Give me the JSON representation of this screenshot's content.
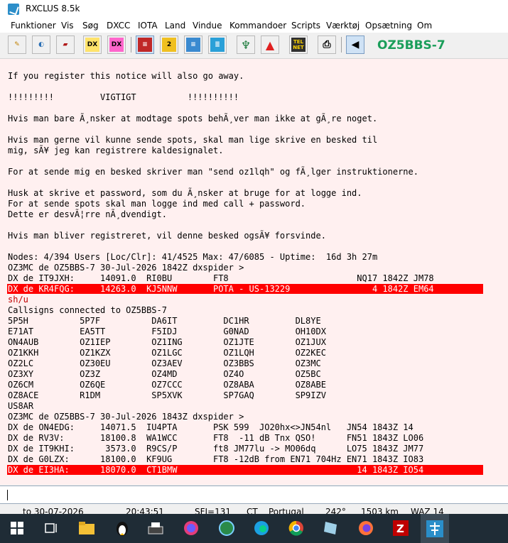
{
  "window": {
    "title": "RXCLUS 8.5k",
    "callsign": "OZ5BBS-7"
  },
  "menu": [
    "Funktioner",
    "Vis",
    "Søg",
    "DXCC",
    "IOTA",
    "Land",
    "Vindue",
    "Kommandoer",
    "Scripts",
    "Værktøj",
    "Opsætning",
    "Om"
  ],
  "toolbar": {
    "buttons": [
      {
        "name": "pin-icon",
        "label": ""
      },
      {
        "name": "radar-icon",
        "label": ""
      },
      {
        "name": "eraser-icon",
        "label": ""
      },
      {
        "name": "dx-icon",
        "label": "DX"
      },
      {
        "name": "magnifier-dx-icon",
        "label": "DX"
      },
      {
        "name": "notebook-icon",
        "label": ""
      },
      {
        "name": "notebook2-icon",
        "label": "2"
      },
      {
        "name": "notes-icon",
        "label": ""
      },
      {
        "name": "list-icon",
        "label": ""
      },
      {
        "name": "antenna-icon",
        "label": ""
      },
      {
        "name": "bell-icon",
        "label": ""
      },
      {
        "name": "telnet-icon",
        "label": "TEL NET"
      },
      {
        "name": "printer-icon",
        "label": ""
      },
      {
        "name": "speaker-icon",
        "label": ""
      }
    ]
  },
  "terminal": {
    "lines": [
      "If you register this notice will also go away.",
      "",
      "!!!!!!!!!         VIGTIGT          !!!!!!!!!!",
      "",
      "Hvis man bare Ã¸nsker at modtage spots behÃ¸ver man ikke at gÃ¸re noget.",
      "",
      "Hvis man gerne vil kunne sende spots, skal man lige skrive en besked til",
      "mig, sÃ¥ jeg kan registrere kaldesignalet.",
      "",
      "For at sende mig en besked skriver man \"send oz1lqh\" og fÃ¸lger instruktionerne.",
      "",
      "Husk at skrive et password, som du Ã¸nsker at bruge for at logge ind.",
      "For at sende spots skal man logge ind med call + password.",
      "Dette er desvÃ¦rre nÃ¸dvendigt.",
      "",
      "Hvis man bliver registreret, vil denne besked ogsÃ¥ forsvinde.",
      "",
      "Nodes: 4/394 Users [Loc/Clr]: 41/4525 Max: 47/6085 - Uptime:  16d 3h 27m",
      "OZ3MC de OZ5BBS-7 30-Jul-2026 1842Z dxspider >",
      "DX de IT9JXH:     14091.0  RI0BU        FT8                         NQ17 1842Z JM78",
      "DX de KR4FQG:     14263.0  KJ5NNW       POTA - US-13229                4 1842Z EM64",
      "sh/u",
      "Callsigns connected to OZ5BBS-7",
      "5P5H          5P7F          DA6IT         DC1HR         DL8YE",
      "E71AT         EA5TT         F5IDJ         G0NAD         OH10DX",
      "ON4AUB        OZ1IEP        OZ1ING        OZ1JTE        OZ1JUX",
      "OZ1KKH        OZ1KZX        OZ1LGC        OZ1LQH        OZ2KEC",
      "OZ2LC         OZ30EU        OZ3AEV        OZ3BBS        OZ3MC",
      "OZ3XY         OZ3Z          OZ4MD         OZ4O          OZ5BC",
      "OZ6CM         OZ6QE         OZ7CCC        OZ8ABA        OZ8ABE",
      "OZ8ACE        R1DM          SP5XVK        SP7GAQ        SP9IZV",
      "US8AR",
      "OZ3MC de OZ5BBS-7 30-Jul-2026 1843Z dxspider >",
      "DX de ON4EDG:     14071.5  IU4PTA       PSK 599  JO20hx<>JN54nl   JN54 1843Z 14",
      "DX de RV3V:       18100.8  WA1WCC       FT8  -11 dB Tnx QSO!      FN51 1843Z LO06",
      "DX de IT9KHI:      3573.0  R9CS/P       ft8 JM77lu -> MO06dq      LO75 1843Z JM77",
      "DX de G0LZX:      18100.0  KF9UG        FT8 -12dB from EN71 704Hz EN71 1843Z IO83",
      "DX de EI3HA:      18070.0  CT1BMW                                   14 1843Z IO54"
    ]
  },
  "status": {
    "date": "to 30-07-2026",
    "time": "20:43:51",
    "sfi": "SFI=131",
    "prefix": "CT",
    "country": "Portugal",
    "bearing": "242°",
    "distance": "1503 km",
    "waz": "WAZ 14"
  },
  "taskbar": [
    "windows-start-icon",
    "task-view-icon",
    "file-explorer-icon",
    "linux-penguin-icon",
    "typewriter-icon",
    "color-circle-icon",
    "globe-icon",
    "edge-icon",
    "chrome-icon",
    "notes-app-icon",
    "firefox-icon",
    "filezilla-icon",
    "rxclus-icon"
  ]
}
